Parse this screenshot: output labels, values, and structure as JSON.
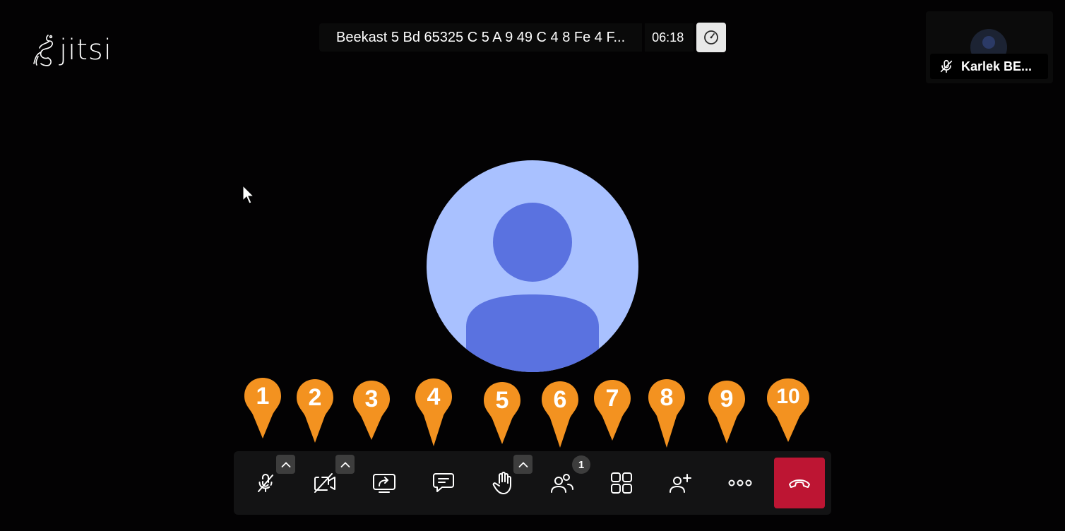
{
  "app": {
    "logo_text": "jitsi"
  },
  "meeting": {
    "subject": "Beekast 5 Bd 65325 C 5 A 9 49 C 4 8 Fe 4 F...",
    "timer": "06:18",
    "connection_icon": "speedometer-icon"
  },
  "participant_tile": {
    "name": "Karlek BE...",
    "mic_icon": "mic-muted-icon"
  },
  "markers": [
    {
      "label": "1"
    },
    {
      "label": "2"
    },
    {
      "label": "3"
    },
    {
      "label": "4"
    },
    {
      "label": "5"
    },
    {
      "label": "6"
    },
    {
      "label": "7"
    },
    {
      "label": "8"
    },
    {
      "label": "9"
    },
    {
      "label": "10"
    }
  ],
  "toolbar": {
    "participants_badge": "1",
    "buttons": [
      {
        "name": "microphone",
        "icon": "mic-muted-icon"
      },
      {
        "name": "camera",
        "icon": "camera-off-icon"
      },
      {
        "name": "share-screen",
        "icon": "share-screen-icon"
      },
      {
        "name": "chat",
        "icon": "chat-icon"
      },
      {
        "name": "raise-hand",
        "icon": "hand-icon"
      },
      {
        "name": "participants",
        "icon": "participants-icon"
      },
      {
        "name": "tile-view",
        "icon": "tile-view-icon"
      },
      {
        "name": "invite",
        "icon": "add-person-icon"
      },
      {
        "name": "more",
        "icon": "more-icon"
      },
      {
        "name": "hangup",
        "icon": "hangup-icon"
      }
    ]
  },
  "colors": {
    "background": "#030203",
    "marker": "#f39220",
    "hangup": "#bd1533",
    "avatar_bg": "#a9c1ff",
    "avatar_fg": "#5a72e0"
  }
}
